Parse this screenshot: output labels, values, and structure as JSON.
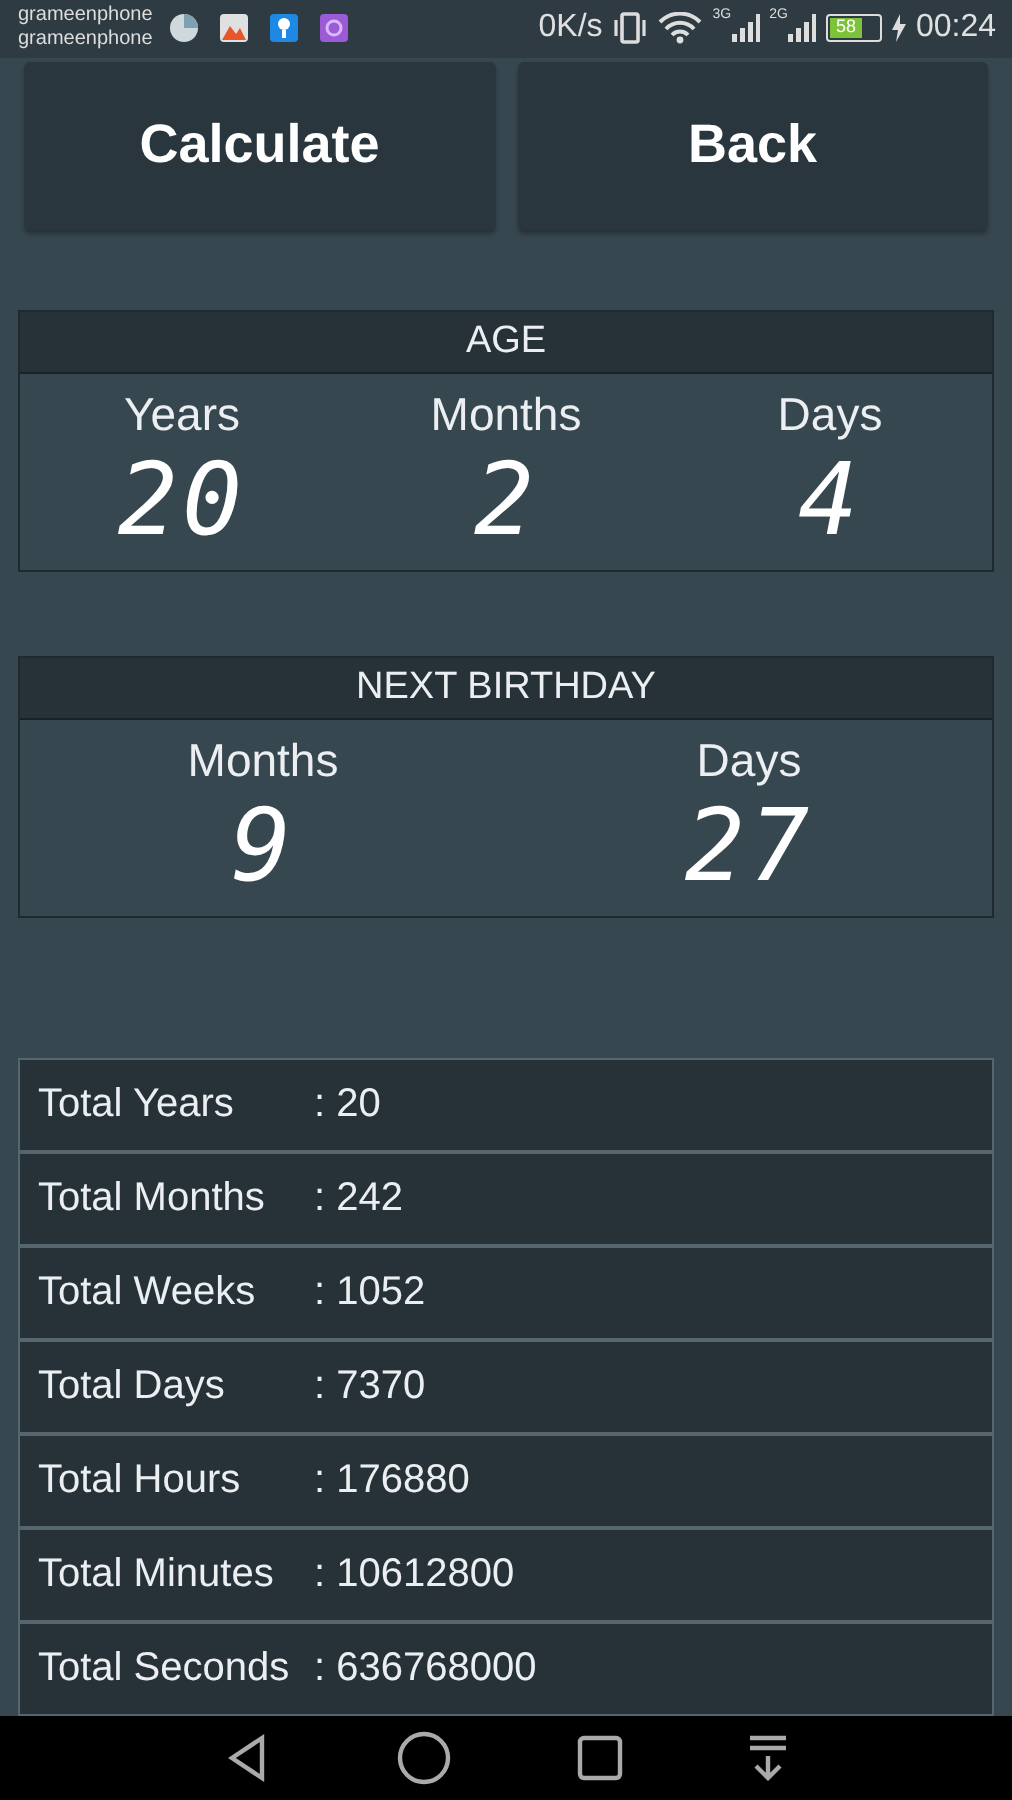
{
  "status_bar": {
    "carriers": [
      "grameenphone",
      "grameenphone"
    ],
    "speed": "0K/s",
    "signals": [
      {
        "label": "3G"
      },
      {
        "label": "2G"
      }
    ],
    "battery": "58",
    "time": "00:24"
  },
  "buttons": [
    {
      "label": "Calculate"
    },
    {
      "label": "Back"
    }
  ],
  "age": {
    "title": "AGE",
    "fields": [
      {
        "label": "Years",
        "value": "20"
      },
      {
        "label": "Months",
        "value": "2"
      },
      {
        "label": "Days",
        "value": "4"
      }
    ]
  },
  "next_birthday": {
    "title": "NEXT BIRTHDAY",
    "fields": [
      {
        "label": "Months",
        "value": "9"
      },
      {
        "label": "Days",
        "value": "27"
      }
    ]
  },
  "totals": [
    {
      "label": "Total Years",
      "value": ": 20"
    },
    {
      "label": "Total Months",
      "value": ": 242"
    },
    {
      "label": "Total Weeks",
      "value": ": 1052"
    },
    {
      "label": "Total Days",
      "value": ": 7370"
    },
    {
      "label": "Total Hours",
      "value": ": 176880"
    },
    {
      "label": "Total Minutes",
      "value": ": 10612800"
    },
    {
      "label": "Total Seconds",
      "value": ": 636768000"
    }
  ]
}
